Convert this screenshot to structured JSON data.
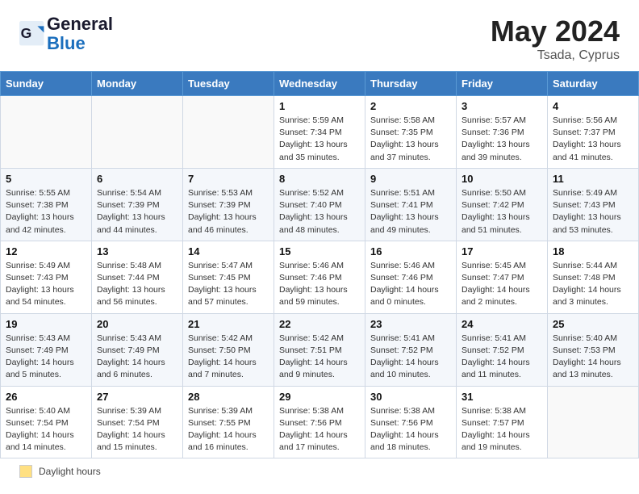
{
  "header": {
    "logo_text_general": "General",
    "logo_text_blue": "Blue",
    "month": "May 2024",
    "location": "Tsada, Cyprus"
  },
  "legend": {
    "box_label": "Daylight hours"
  },
  "weekdays": [
    "Sunday",
    "Monday",
    "Tuesday",
    "Wednesday",
    "Thursday",
    "Friday",
    "Saturday"
  ],
  "weeks": [
    {
      "days": [
        {
          "num": "",
          "detail": ""
        },
        {
          "num": "",
          "detail": ""
        },
        {
          "num": "",
          "detail": ""
        },
        {
          "num": "1",
          "detail": "Sunrise: 5:59 AM\nSunset: 7:34 PM\nDaylight: 13 hours\nand 35 minutes."
        },
        {
          "num": "2",
          "detail": "Sunrise: 5:58 AM\nSunset: 7:35 PM\nDaylight: 13 hours\nand 37 minutes."
        },
        {
          "num": "3",
          "detail": "Sunrise: 5:57 AM\nSunset: 7:36 PM\nDaylight: 13 hours\nand 39 minutes."
        },
        {
          "num": "4",
          "detail": "Sunrise: 5:56 AM\nSunset: 7:37 PM\nDaylight: 13 hours\nand 41 minutes."
        }
      ]
    },
    {
      "days": [
        {
          "num": "5",
          "detail": "Sunrise: 5:55 AM\nSunset: 7:38 PM\nDaylight: 13 hours\nand 42 minutes."
        },
        {
          "num": "6",
          "detail": "Sunrise: 5:54 AM\nSunset: 7:39 PM\nDaylight: 13 hours\nand 44 minutes."
        },
        {
          "num": "7",
          "detail": "Sunrise: 5:53 AM\nSunset: 7:39 PM\nDaylight: 13 hours\nand 46 minutes."
        },
        {
          "num": "8",
          "detail": "Sunrise: 5:52 AM\nSunset: 7:40 PM\nDaylight: 13 hours\nand 48 minutes."
        },
        {
          "num": "9",
          "detail": "Sunrise: 5:51 AM\nSunset: 7:41 PM\nDaylight: 13 hours\nand 49 minutes."
        },
        {
          "num": "10",
          "detail": "Sunrise: 5:50 AM\nSunset: 7:42 PM\nDaylight: 13 hours\nand 51 minutes."
        },
        {
          "num": "11",
          "detail": "Sunrise: 5:49 AM\nSunset: 7:43 PM\nDaylight: 13 hours\nand 53 minutes."
        }
      ]
    },
    {
      "days": [
        {
          "num": "12",
          "detail": "Sunrise: 5:49 AM\nSunset: 7:43 PM\nDaylight: 13 hours\nand 54 minutes."
        },
        {
          "num": "13",
          "detail": "Sunrise: 5:48 AM\nSunset: 7:44 PM\nDaylight: 13 hours\nand 56 minutes."
        },
        {
          "num": "14",
          "detail": "Sunrise: 5:47 AM\nSunset: 7:45 PM\nDaylight: 13 hours\nand 57 minutes."
        },
        {
          "num": "15",
          "detail": "Sunrise: 5:46 AM\nSunset: 7:46 PM\nDaylight: 13 hours\nand 59 minutes."
        },
        {
          "num": "16",
          "detail": "Sunrise: 5:46 AM\nSunset: 7:46 PM\nDaylight: 14 hours\nand 0 minutes."
        },
        {
          "num": "17",
          "detail": "Sunrise: 5:45 AM\nSunset: 7:47 PM\nDaylight: 14 hours\nand 2 minutes."
        },
        {
          "num": "18",
          "detail": "Sunrise: 5:44 AM\nSunset: 7:48 PM\nDaylight: 14 hours\nand 3 minutes."
        }
      ]
    },
    {
      "days": [
        {
          "num": "19",
          "detail": "Sunrise: 5:43 AM\nSunset: 7:49 PM\nDaylight: 14 hours\nand 5 minutes."
        },
        {
          "num": "20",
          "detail": "Sunrise: 5:43 AM\nSunset: 7:49 PM\nDaylight: 14 hours\nand 6 minutes."
        },
        {
          "num": "21",
          "detail": "Sunrise: 5:42 AM\nSunset: 7:50 PM\nDaylight: 14 hours\nand 7 minutes."
        },
        {
          "num": "22",
          "detail": "Sunrise: 5:42 AM\nSunset: 7:51 PM\nDaylight: 14 hours\nand 9 minutes."
        },
        {
          "num": "23",
          "detail": "Sunrise: 5:41 AM\nSunset: 7:52 PM\nDaylight: 14 hours\nand 10 minutes."
        },
        {
          "num": "24",
          "detail": "Sunrise: 5:41 AM\nSunset: 7:52 PM\nDaylight: 14 hours\nand 11 minutes."
        },
        {
          "num": "25",
          "detail": "Sunrise: 5:40 AM\nSunset: 7:53 PM\nDaylight: 14 hours\nand 13 minutes."
        }
      ]
    },
    {
      "days": [
        {
          "num": "26",
          "detail": "Sunrise: 5:40 AM\nSunset: 7:54 PM\nDaylight: 14 hours\nand 14 minutes."
        },
        {
          "num": "27",
          "detail": "Sunrise: 5:39 AM\nSunset: 7:54 PM\nDaylight: 14 hours\nand 15 minutes."
        },
        {
          "num": "28",
          "detail": "Sunrise: 5:39 AM\nSunset: 7:55 PM\nDaylight: 14 hours\nand 16 minutes."
        },
        {
          "num": "29",
          "detail": "Sunrise: 5:38 AM\nSunset: 7:56 PM\nDaylight: 14 hours\nand 17 minutes."
        },
        {
          "num": "30",
          "detail": "Sunrise: 5:38 AM\nSunset: 7:56 PM\nDaylight: 14 hours\nand 18 minutes."
        },
        {
          "num": "31",
          "detail": "Sunrise: 5:38 AM\nSunset: 7:57 PM\nDaylight: 14 hours\nand 19 minutes."
        },
        {
          "num": "",
          "detail": ""
        }
      ]
    }
  ]
}
